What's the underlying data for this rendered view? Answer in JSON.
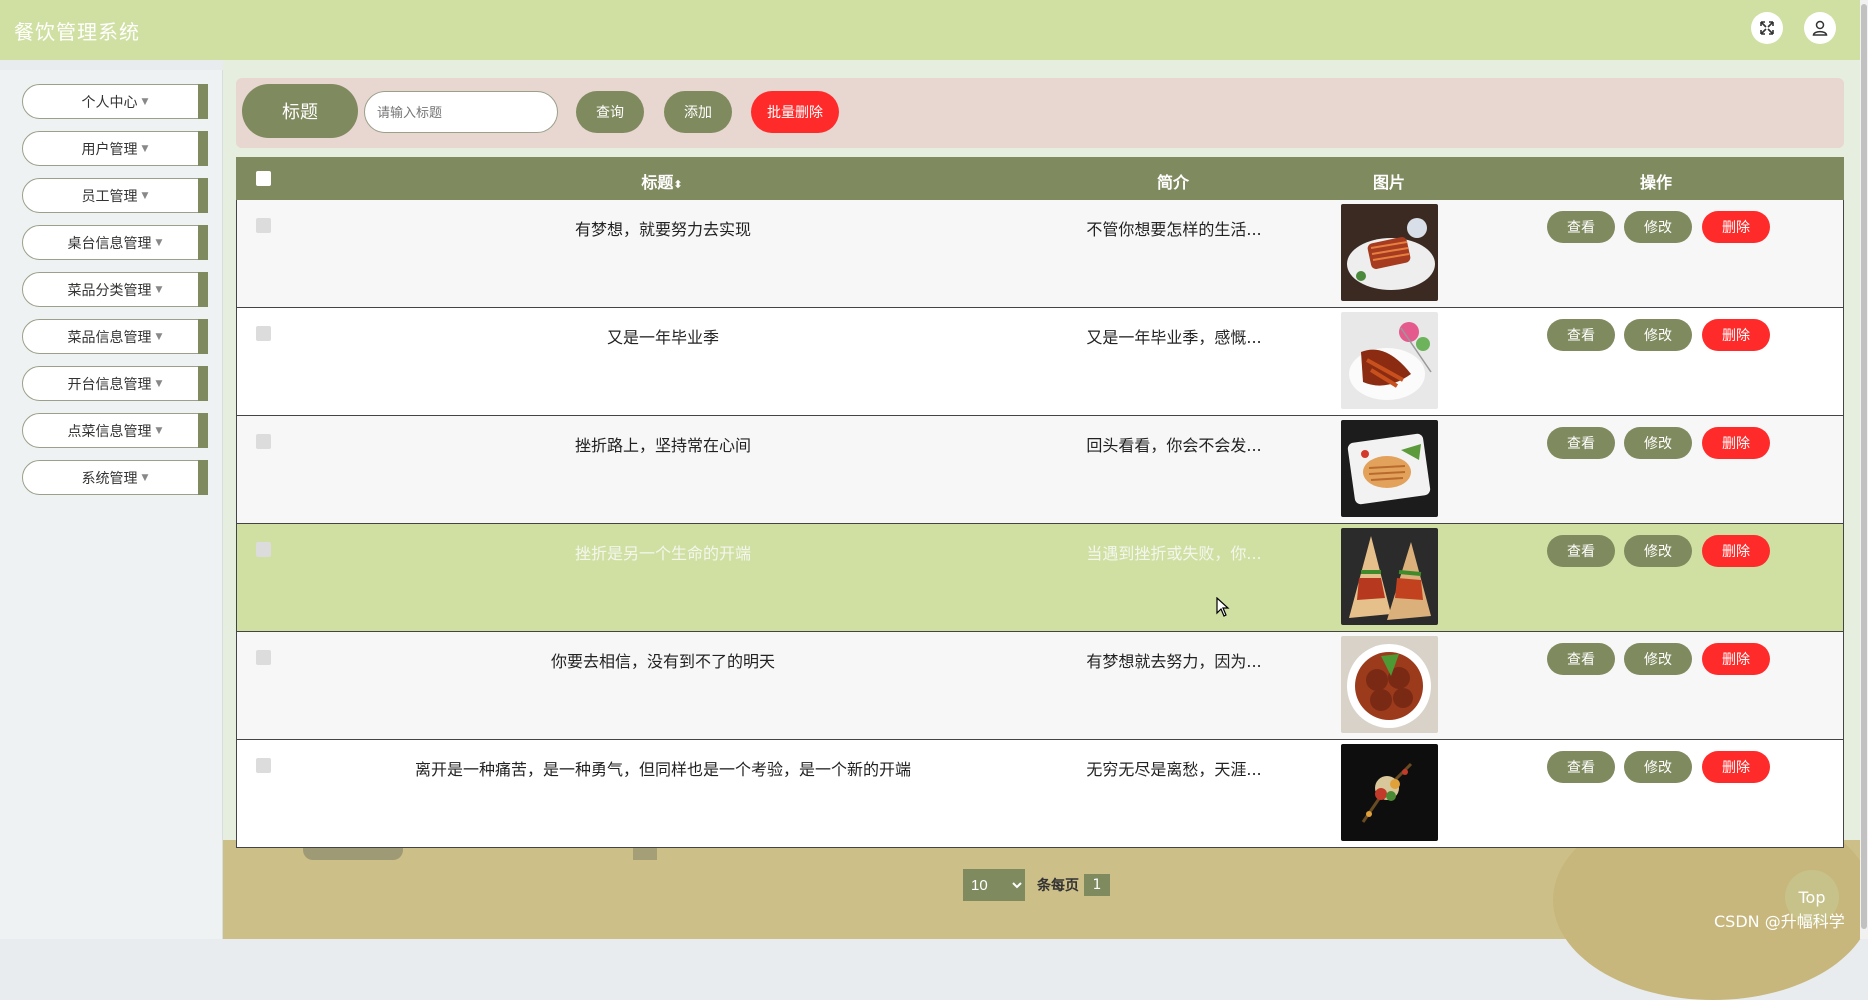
{
  "header": {
    "app_title": "餐饮管理系统"
  },
  "sidebar": {
    "items": [
      {
        "label": "个人中心"
      },
      {
        "label": "用户管理"
      },
      {
        "label": "员工管理"
      },
      {
        "label": "桌台信息管理"
      },
      {
        "label": "菜品分类管理"
      },
      {
        "label": "菜品信息管理"
      },
      {
        "label": "开台信息管理"
      },
      {
        "label": "点菜信息管理"
      },
      {
        "label": "系统管理"
      }
    ]
  },
  "search": {
    "field_label": "标题",
    "placeholder": "请输入标题",
    "query_label": "查询",
    "add_label": "添加",
    "batch_delete_label": "批量删除"
  },
  "table": {
    "columns": [
      "标题",
      "简介",
      "图片",
      "操作"
    ],
    "sort_icon": "sort-icon",
    "rows": [
      {
        "title": "有梦想，就要努力去实现",
        "intro": "不管你想要怎样的生活...",
        "image": "salmon-dish-image"
      },
      {
        "title": "又是一年毕业季",
        "intro": "又是一年毕业季，感慨...",
        "image": "bbq-skewers-image"
      },
      {
        "title": "挫折路上，坚持常在心间",
        "intro": "回头看看，你会不会发...",
        "image": "sliced-meat-platter-image"
      },
      {
        "title": "挫折是另一个生命的开端",
        "intro": "当遇到挫折或失败，你...",
        "image": "wraps-image"
      },
      {
        "title": "你要去相信，没有到不了的明天",
        "intro": "有梦想就去努力，因为...",
        "image": "meatballs-image"
      },
      {
        "title": "离开是一种痛苦，是一种勇气，但同样也是一个考验，是一个新的开端",
        "intro": "无穷无尽是离愁，天涯...",
        "image": "plated-dish-image"
      }
    ],
    "highlighted_row": 4,
    "actions": {
      "view": "查看",
      "edit": "修改",
      "delete": "删除"
    }
  },
  "pagination": {
    "page_size": "10",
    "per_page_label": "条每页",
    "current_page": "1"
  },
  "back_to_top": "Top",
  "watermark": "CSDN @升幅科学",
  "colors": {
    "primary": "#7f8a5e",
    "header": "#d0e0a2",
    "danger": "#ff2b2b",
    "search_bg": "#e8d6d0"
  }
}
